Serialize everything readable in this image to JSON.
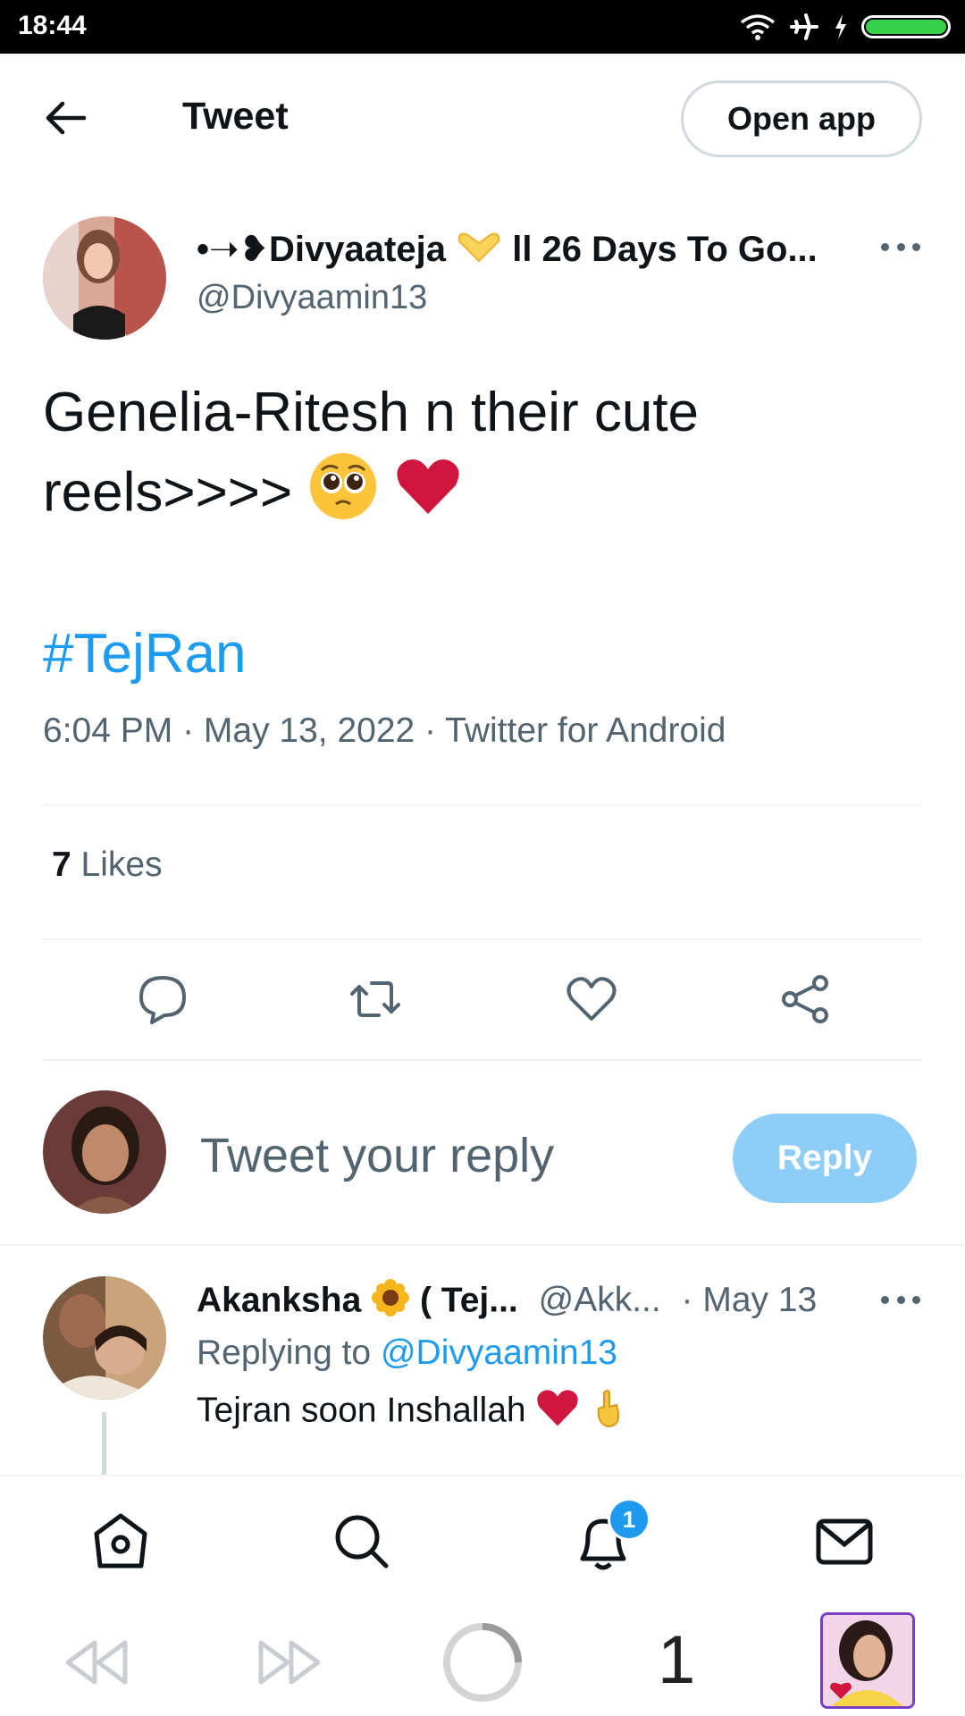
{
  "status_bar": {
    "time": "18:44"
  },
  "header": {
    "title": "Tweet",
    "open_app_label": "Open app"
  },
  "tweet": {
    "author_name": "•➝❥Divyaateja",
    "author_suffix": "ll 26 Days To Go...",
    "handle": "@Divyaamin13",
    "text_line1": "Genelia-Ritesh n their cute",
    "text_line2": "reels>>>>",
    "hashtag": "#TejRan",
    "meta": "6:04 PM · May 13, 2022 · Twitter for Android",
    "likes_count": "7",
    "likes_label": "Likes"
  },
  "reply_box": {
    "placeholder": "Tweet your reply",
    "button_label": "Reply"
  },
  "replies": [
    {
      "author_name": "Akanksha",
      "author_suffix": "( Tej...",
      "handle": "@Akk...",
      "date": "· May 13",
      "replying_label": "Replying to",
      "replying_mention": "@Divyaamin13",
      "text": "Tejran soon Inshallah"
    }
  ],
  "nav": {
    "notifications_badge": "1"
  },
  "browser": {
    "tab_count": "1"
  },
  "colors": {
    "accent": "#1d9bf0",
    "reply_button": "#8ecdf8",
    "muted_text": "#536471",
    "heart": "#d0163e"
  }
}
